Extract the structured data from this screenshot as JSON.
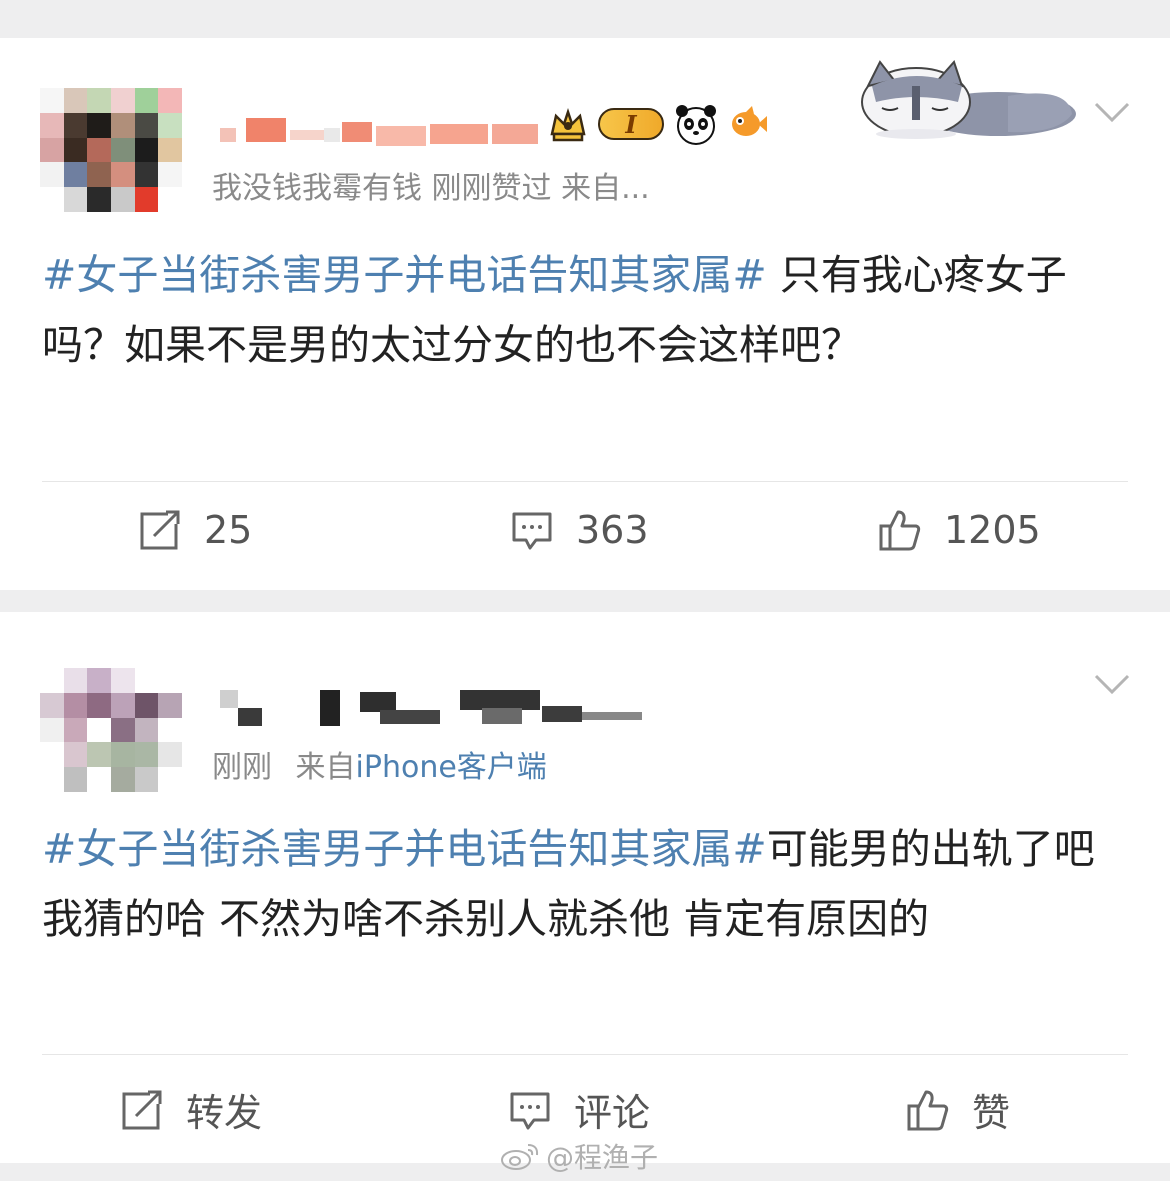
{
  "posts": [
    {
      "badges": {
        "level": "I"
      },
      "meta": {
        "text": "我没钱我霉有钱 刚刚赞过  来自..."
      },
      "content": {
        "hashtag": "#女子当街杀害男子并电话告知其家属#",
        "text": " 只有我心疼女子吗？如果不是男的太过分女的也不会这样吧？"
      },
      "actions": {
        "repost": "25",
        "comment": "363",
        "like": "1205"
      }
    },
    {
      "meta": {
        "time": "刚刚",
        "source_prefix": "来自",
        "client": "iPhone客户端"
      },
      "content": {
        "hashtag": "#女子当街杀害男子并电话告知其家属#",
        "text": "可能男的出轨了吧 我猜的哈 不然为啥不杀别人就杀他 肯定有原因的"
      },
      "actions": {
        "repost": "转发",
        "comment": "评论",
        "like": "赞"
      }
    }
  ],
  "watermark": "@程渔子",
  "colors": {
    "hashtag": "#4e80b0",
    "meta": "#8a8a8a",
    "separator": "#eeeeef"
  },
  "icons": {
    "repost": "repost-icon",
    "comment": "comment-icon",
    "like": "thumbs-up-icon",
    "more": "chevron-down-icon"
  }
}
